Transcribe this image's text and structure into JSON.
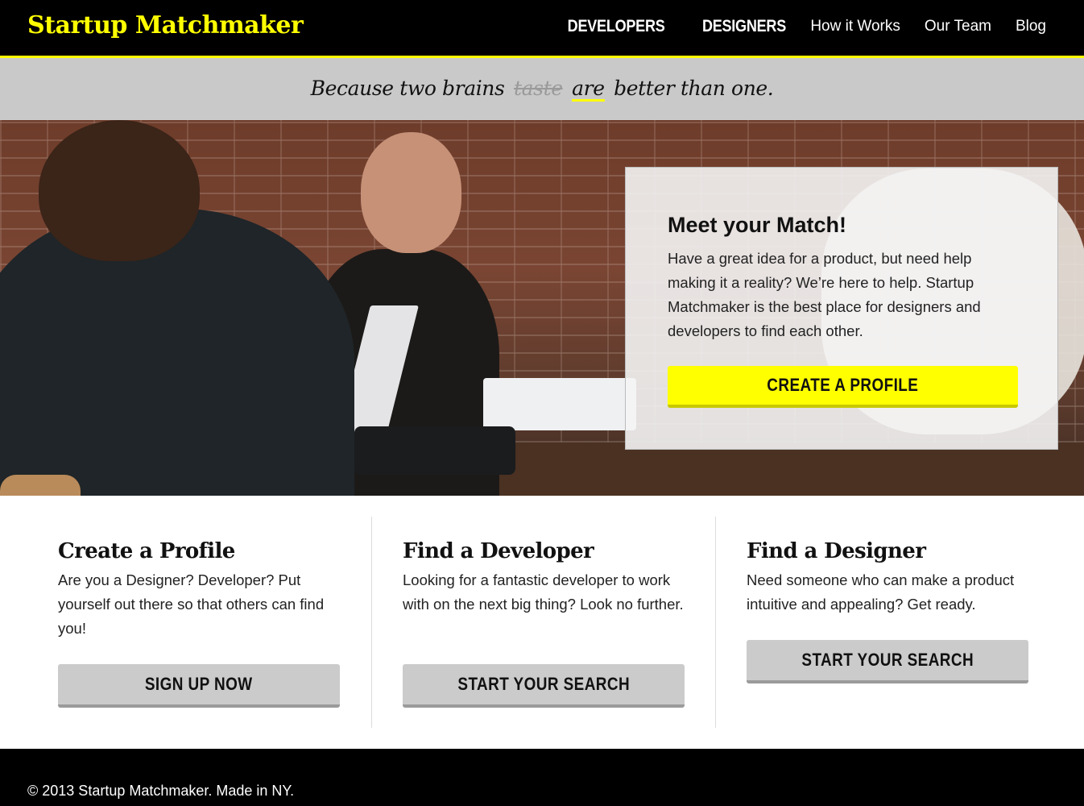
{
  "header": {
    "logo": "Startup Matchmaker",
    "nav": [
      {
        "label": "DEVELOPERS"
      },
      {
        "label": "DESIGNERS"
      },
      {
        "label": "How it Works"
      },
      {
        "label": "Our Team"
      },
      {
        "label": "Blog"
      }
    ]
  },
  "tagline": {
    "before": "Because two brains",
    "struck": "taste",
    "underlined": "are",
    "after": "better than one."
  },
  "hero": {
    "title": "Meet your Match!",
    "text": "Have a great idea for a product, but need help making it a reality? We’re here to help. Startup Matchmaker is the best place for designers and developers to find each other.",
    "button": "CREATE A PROFILE"
  },
  "features": [
    {
      "title": "Create a Profile",
      "text": "Are you a Designer? Developer? Put yourself out there so that others can find you!",
      "button": "SIGN UP NOW"
    },
    {
      "title": "Find a Developer",
      "text": "Looking for a fantastic developer to work with on the next big thing? Look no further.",
      "button": "START YOUR SEARCH"
    },
    {
      "title": "Find a Designer",
      "text": "Need someone who can make a product intuitive and appealing? Get ready.",
      "button": "START YOUR SEARCH"
    }
  ],
  "footer": {
    "text": "© 2013 Startup Matchmaker. Made in NY."
  },
  "colors": {
    "accent": "#ffff00",
    "header_bg": "#000000",
    "band_bg": "#c9c9c9",
    "button_gray": "#cbcbcb"
  }
}
